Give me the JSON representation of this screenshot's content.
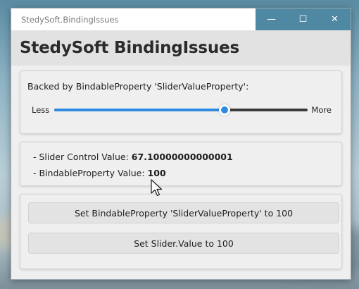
{
  "window": {
    "title": "StedySoft.BindingIssues",
    "minimize_glyph": "—",
    "maximize_glyph": "☐",
    "close_glyph": "✕"
  },
  "header": {
    "title": "StedySoft BindingIssues"
  },
  "slider_panel": {
    "caption": "Backed by BindableProperty 'SliderValueProperty':",
    "min_label": "Less",
    "max_label": "More",
    "value": 67.10000000000001,
    "minimum": 0,
    "maximum": 100,
    "accent_color": "#2f8be0"
  },
  "values_panel": {
    "slider_value_label": "- Slider Control Value:",
    "slider_value": "67.10000000000001",
    "bindable_value_label": "- BindableProperty Value:",
    "bindable_value": "100"
  },
  "buttons_panel": {
    "set_bindable_label": "Set BindableProperty 'SliderValueProperty' to 100",
    "set_slider_label": "Set Slider.Value to 100"
  },
  "icons": {
    "cursor": "arrow-cursor-icon"
  }
}
